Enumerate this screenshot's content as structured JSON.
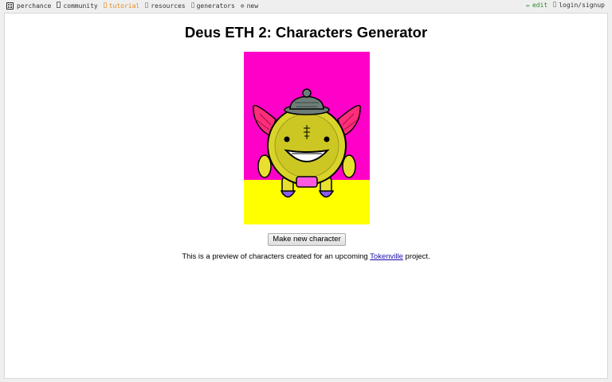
{
  "colors": {
    "tutorial_accent": "#e68a1e",
    "edit_accent": "#2a8a2a",
    "link": "#1a0dab",
    "image_background_top": "#ff00c8",
    "image_background_bottom": "#ffff00",
    "character_body": "#d9d42a",
    "character_wings": "#ff2d7a",
    "character_feet": "#8a5cf0",
    "character_belt": "#ff5ae0",
    "character_hat": "#6f7d78"
  },
  "topbar": {
    "nav": [
      {
        "label": "perchance",
        "icon": "dice-icon"
      },
      {
        "label": "community",
        "icon": "chat-icon"
      },
      {
        "label": "tutorial",
        "icon": "book-icon"
      },
      {
        "label": "resources",
        "icon": "folder-icon"
      },
      {
        "label": "generators",
        "icon": "list-icon"
      },
      {
        "label": "new",
        "icon": "plus-circle-icon",
        "glyph": "⊕"
      }
    ],
    "right": [
      {
        "label": "edit",
        "icon": "pencil-icon",
        "glyph": "✏"
      },
      {
        "label": "login/signup",
        "icon": "user-icon"
      }
    ]
  },
  "main": {
    "title": "Deus ETH 2: Characters Generator",
    "image_icon": "robot-character-image",
    "button_label": "Make new character",
    "caption_prefix": "This is a preview of characters created for an upcoming ",
    "caption_link": "Tokenville",
    "caption_suffix": " project."
  }
}
